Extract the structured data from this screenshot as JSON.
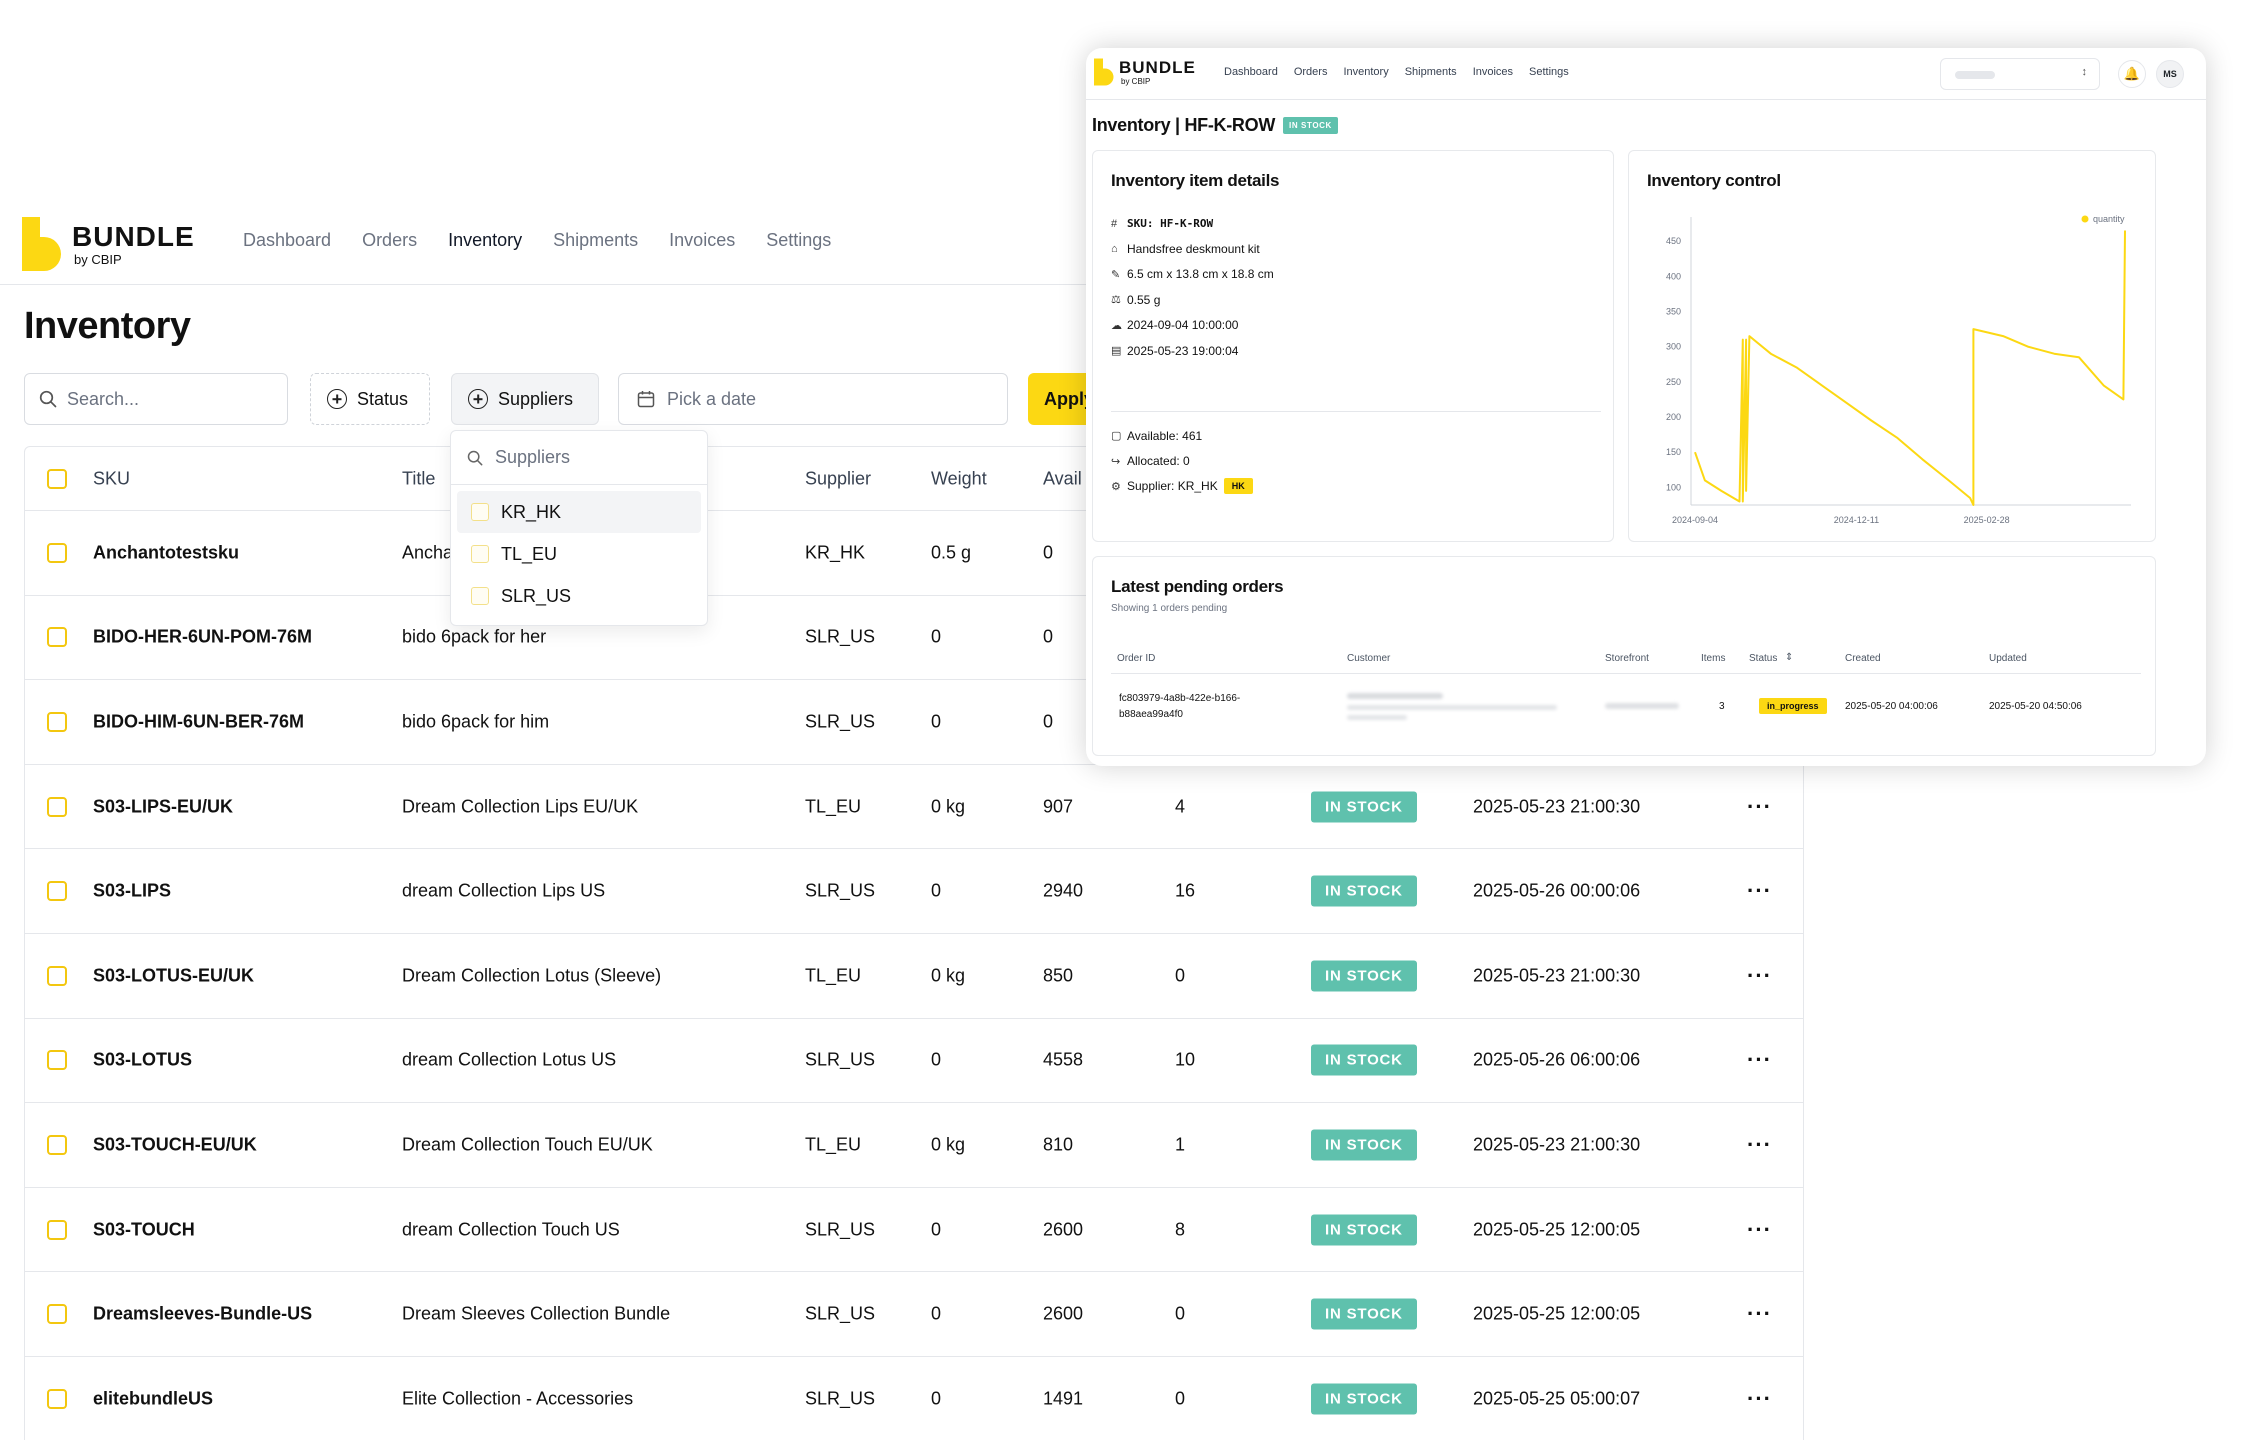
{
  "brand": {
    "name": "BUNDLE",
    "sub": "by CBIP"
  },
  "nav": [
    "Dashboard",
    "Orders",
    "Inventory",
    "Shipments",
    "Invoices",
    "Settings"
  ],
  "nav_active": "Inventory",
  "page_title": "Inventory",
  "toolbar": {
    "search_placeholder": "Search...",
    "status_label": "Status",
    "suppliers_label": "Suppliers",
    "date_placeholder": "Pick a date",
    "apply_label": "Apply"
  },
  "supplier_dropdown": {
    "placeholder": "Suppliers",
    "options": [
      "KR_HK",
      "TL_EU",
      "SLR_US"
    ]
  },
  "table": {
    "headers": {
      "sku": "SKU",
      "title": "Title",
      "supplier": "Supplier",
      "weight": "Weight",
      "available": "Avail"
    },
    "rows": [
      {
        "sku": "Anchantotestsku",
        "title": "Ancha",
        "supplier": "KR_HK",
        "weight": "0.5 g",
        "available": "0",
        "allocated": "",
        "status": "",
        "updated": ""
      },
      {
        "sku": "BIDO-HER-6UN-POM-76M",
        "title": "bido 6pack for her",
        "supplier": "SLR_US",
        "weight": "0",
        "available": "0",
        "allocated": "",
        "status": "",
        "updated": ""
      },
      {
        "sku": "BIDO-HIM-6UN-BER-76M",
        "title": "bido 6pack for him",
        "supplier": "SLR_US",
        "weight": "0",
        "available": "0",
        "allocated": "",
        "status": "",
        "updated": ""
      },
      {
        "sku": "S03-LIPS-EU/UK",
        "title": "Dream Collection Lips EU/UK",
        "supplier": "TL_EU",
        "weight": "0 kg",
        "available": "907",
        "allocated": "4",
        "status": "IN STOCK",
        "updated": "2025-05-23 21:00:30"
      },
      {
        "sku": "S03-LIPS",
        "title": "dream Collection Lips US",
        "supplier": "SLR_US",
        "weight": "0",
        "available": "2940",
        "allocated": "16",
        "status": "IN STOCK",
        "updated": "2025-05-26 00:00:06"
      },
      {
        "sku": "S03-LOTUS-EU/UK",
        "title": "Dream Collection Lotus (Sleeve)",
        "supplier": "TL_EU",
        "weight": "0 kg",
        "available": "850",
        "allocated": "0",
        "status": "IN STOCK",
        "updated": "2025-05-23 21:00:30"
      },
      {
        "sku": "S03-LOTUS",
        "title": "dream Collection Lotus US",
        "supplier": "SLR_US",
        "weight": "0",
        "available": "4558",
        "allocated": "10",
        "status": "IN STOCK",
        "updated": "2025-05-26 06:00:06"
      },
      {
        "sku": "S03-TOUCH-EU/UK",
        "title": "Dream Collection Touch EU/UK",
        "supplier": "TL_EU",
        "weight": "0 kg",
        "available": "810",
        "allocated": "1",
        "status": "IN STOCK",
        "updated": "2025-05-23 21:00:30"
      },
      {
        "sku": "S03-TOUCH",
        "title": "dream Collection Touch US",
        "supplier": "SLR_US",
        "weight": "0",
        "available": "2600",
        "allocated": "8",
        "status": "IN STOCK",
        "updated": "2025-05-25 12:00:05"
      },
      {
        "sku": "Dreamsleeves-Bundle-US",
        "title": "Dream Sleeves Collection Bundle",
        "supplier": "SLR_US",
        "weight": "0",
        "available": "2600",
        "allocated": "0",
        "status": "IN STOCK",
        "updated": "2025-05-25 12:00:05"
      },
      {
        "sku": "elitebundleUS",
        "title": "Elite Collection - Accessories",
        "supplier": "SLR_US",
        "weight": "0",
        "available": "1491",
        "allocated": "0",
        "status": "IN STOCK",
        "updated": "2025-05-25 05:00:07"
      }
    ]
  },
  "detail_window": {
    "title": "Inventory | HF-K-ROW",
    "status": "IN STOCK",
    "avatar": "MS",
    "details": {
      "title": "Inventory item details",
      "sku": "SKU: HF-K-ROW",
      "name": "Handsfree deskmount kit",
      "dimensions": "6.5 cm x 13.8 cm x 18.8 cm",
      "weight": "0.55 g",
      "created": "2024-09-04 10:00:00",
      "updated": "2025-05-23 19:00:04",
      "available": "Available: 461",
      "allocated": "Allocated: 0",
      "supplier": "Supplier: KR_HK",
      "supplier_badge": "HK"
    },
    "control_title": "Inventory control",
    "orders": {
      "title": "Latest pending orders",
      "subtitle": "Showing 1 orders pending",
      "headers": {
        "order_id": "Order ID",
        "customer": "Customer",
        "storefront": "Storefront",
        "items": "Items",
        "status": "Status",
        "created": "Created",
        "updated": "Updated"
      },
      "row": {
        "order_id_1": "fc803979-4a8b-422e-b166-",
        "order_id_2": "b88aea99a4f0",
        "items": "3",
        "status": "in_progress",
        "created": "2025-05-20 04:00:06",
        "updated": "2025-05-20 04:50:06"
      }
    }
  },
  "chart_data": {
    "type": "line",
    "title": "Inventory control",
    "series": [
      {
        "name": "quantity",
        "color": "#fcd813",
        "x": [
          "2024-09-04",
          "2024-09-10",
          "2024-09-20",
          "2024-10-01",
          "2024-10-03",
          "2024-10-03",
          "2024-10-05",
          "2024-10-05",
          "2024-10-07",
          "2024-10-20",
          "2024-11-05",
          "2024-11-20",
          "2024-12-05",
          "2024-12-20",
          "2025-01-05",
          "2025-01-20",
          "2025-02-05",
          "2025-02-18",
          "2025-02-20",
          "2025-02-20",
          "2025-03-01",
          "2025-03-10",
          "2025-03-25",
          "2025-04-10",
          "2025-04-25",
          "2025-05-10",
          "2025-05-22",
          "2025-05-23"
        ],
        "y": [
          150,
          110,
          95,
          80,
          310,
          80,
          310,
          95,
          315,
          290,
          270,
          245,
          220,
          195,
          170,
          140,
          110,
          85,
          75,
          325,
          320,
          315,
          300,
          290,
          285,
          245,
          225,
          465
        ]
      }
    ],
    "yticks": [
      100,
      150,
      200,
      250,
      300,
      350,
      400,
      450
    ],
    "xticks": [
      "2024-09-04",
      "2024-12-11",
      "2025-02-28"
    ],
    "ylim": [
      75,
      470
    ],
    "legend": "top-right",
    "grid": false
  }
}
